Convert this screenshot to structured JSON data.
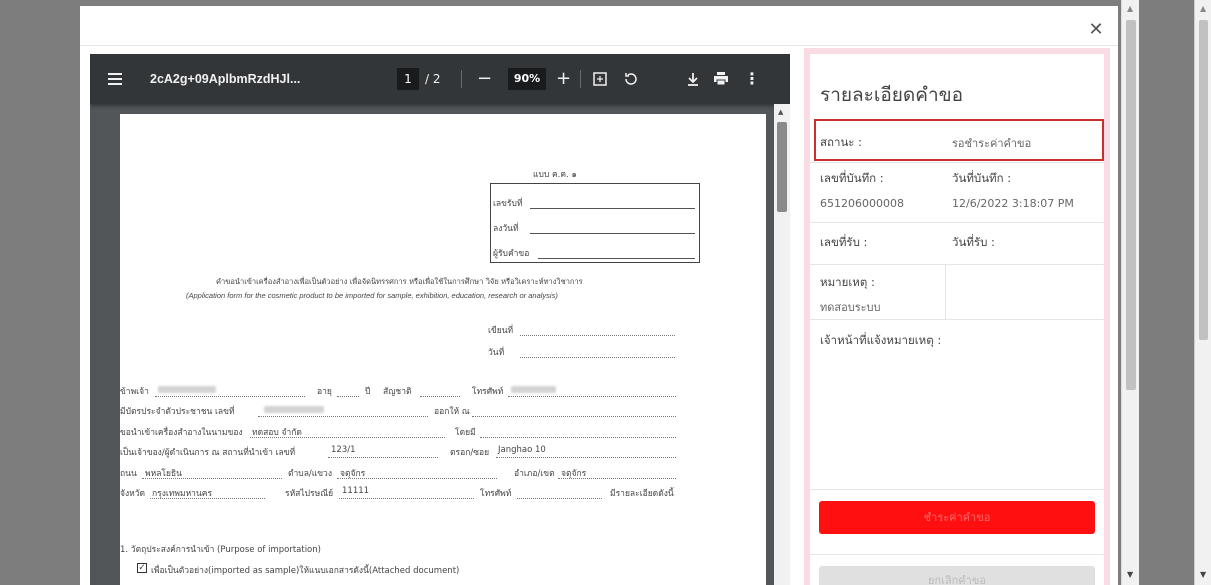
{
  "pdf_viewer": {
    "title": "2cA2g+09AplbmRzdHJl...",
    "current_page": "1",
    "page_sep": "/ 2",
    "zoom": "90%"
  },
  "paper": {
    "form_code": "แบบ ค.ค. ๑",
    "receipt_no_label": "เลขรับที่",
    "receipt_date_label": "ลงวันที่",
    "receiver_label": "ผู้รับคำขอ",
    "heading_th": "คำขอนำเข้าเครื่องสำอางเพื่อเป็นตัวอย่าง เพื่อจัดนิทรรศการ หรือเพื่อใช้ในการศึกษา วิจัย หรือวิเคราะห์ทางวิชาการ",
    "heading_en": "(Application form for the cosmetic product to be imported for sample, exhibition, education, research or analysis)",
    "written_at": "เขียนที่",
    "date": "วันที่",
    "i_label": "ข้าพเจ้า",
    "age_label": "อายุ",
    "year_label": "ปี",
    "nationality_label": "สัญชาติ",
    "phone_label": "โทรศัพท์",
    "id_card_label": "มีบัตรประจำตัวประชาชน เลขที่",
    "issued_at_label": "ออกให้ ณ",
    "import_in_name_label": "ขอนำเข้าเครื่องสำอางในนามของ",
    "company_name": "ทดสอบ จำกัด",
    "by_label": "โดยมี",
    "owner_label": "เป็นเจ้าของ/ผู้ดำเนินการ ณ สถานที่นำเข้า เลขที่",
    "address_no": "123/1",
    "alley_label": "ตรอก/ซอย",
    "alley_value": "Janghao 10",
    "road_label": "ถนน",
    "road_value": "พหลโยธิน",
    "subdistrict_label": "ตำบล/แขวง",
    "subdistrict_value": "จตุจักร",
    "district_label": "อำเภอ/เขต",
    "district_value": "จตุจักร",
    "province_label": "จังหวัด",
    "province_value": "กรุงเทพมหานคร",
    "postal_label": "รหัสไปรษณีย์",
    "postal_value": "11111",
    "phone2_label": "โทรศัพท์",
    "details_follow": "มีรายละเอียดดังนี้",
    "purpose_heading": "1. วัตถุประสงค์การนำเข้า (Purpose of importation)",
    "checkbox_text": "เพื่อเป็นตัวอย่าง(imported as sample)ให้แนบเอกสารดังนี้(Attached document)"
  },
  "details": {
    "title": "รายละเอียดคำขอ",
    "status_label": "สถานะ :",
    "status_value": "รอชำระค่าคำขอ",
    "record_no_label": "เลขที่บันทึก :",
    "record_no_value": "651206000008",
    "record_date_label": "วันที่บันทึก :",
    "record_date_value": "12/6/2022 3:18:07 PM",
    "receive_no_label": "เลขที่รับ :",
    "receive_date_label": "วันที่รับ :",
    "remark_label": "หมายเหตุ :",
    "remark_value": "ทดสอบระบบ",
    "officer_label": "เจ้าหน้าที่แจ้งหมายเหตุ :",
    "red_button": "ชำระค่าคำขอ",
    "gray_button": "ยกเลิกคำขอ"
  },
  "colors": {
    "status_border": "#c9302c",
    "red_button": "#ff0f0f",
    "panel_border": "#f9dbe4",
    "pdf_toolbar": "#323639"
  }
}
